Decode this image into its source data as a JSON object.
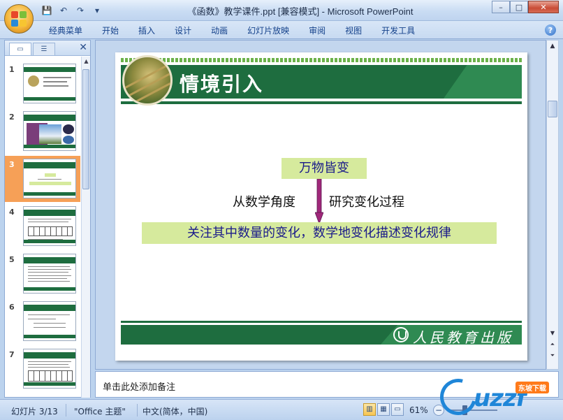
{
  "window": {
    "title": "《函数》教学课件.ppt [兼容模式] - Microsoft PowerPoint",
    "minimize": "–",
    "maximize": "□",
    "close": "✕"
  },
  "quick_access": {
    "save_icon": "💾",
    "undo_icon": "↶",
    "redo_icon": "↷",
    "customize_icon": "▾"
  },
  "ribbon": {
    "tabs": [
      "经典菜单",
      "开始",
      "插入",
      "设计",
      "动画",
      "幻灯片放映",
      "审阅",
      "视图",
      "开发工具"
    ],
    "help": "?"
  },
  "left_pane": {
    "close": "✕",
    "slides": [
      {
        "num": "1"
      },
      {
        "num": "2"
      },
      {
        "num": "3"
      },
      {
        "num": "4"
      },
      {
        "num": "5"
      },
      {
        "num": "6"
      },
      {
        "num": "7"
      }
    ],
    "selected_index": 3
  },
  "slide": {
    "title": "情境引入",
    "box_top": "万物皆变",
    "label_left": "从数学角度",
    "label_right": "研究变化过程",
    "box_bottom": "关注其中数量的变化，数学地变化描述变化规律",
    "publisher": "人民教育出版社",
    "colors": {
      "green": "#1e6d3f",
      "box": "#d6ea9d",
      "arrow": "#a0287a"
    }
  },
  "notes": {
    "placeholder": "单击此处添加备注"
  },
  "status": {
    "slide_info": "幻灯片 3/13",
    "theme": "\"Office 主题\"",
    "language": "中文(简体，中国)",
    "zoom": "61%",
    "zoom_minus": "−"
  },
  "watermark": {
    "text": "uzzf",
    "badge": "东坡下载"
  }
}
